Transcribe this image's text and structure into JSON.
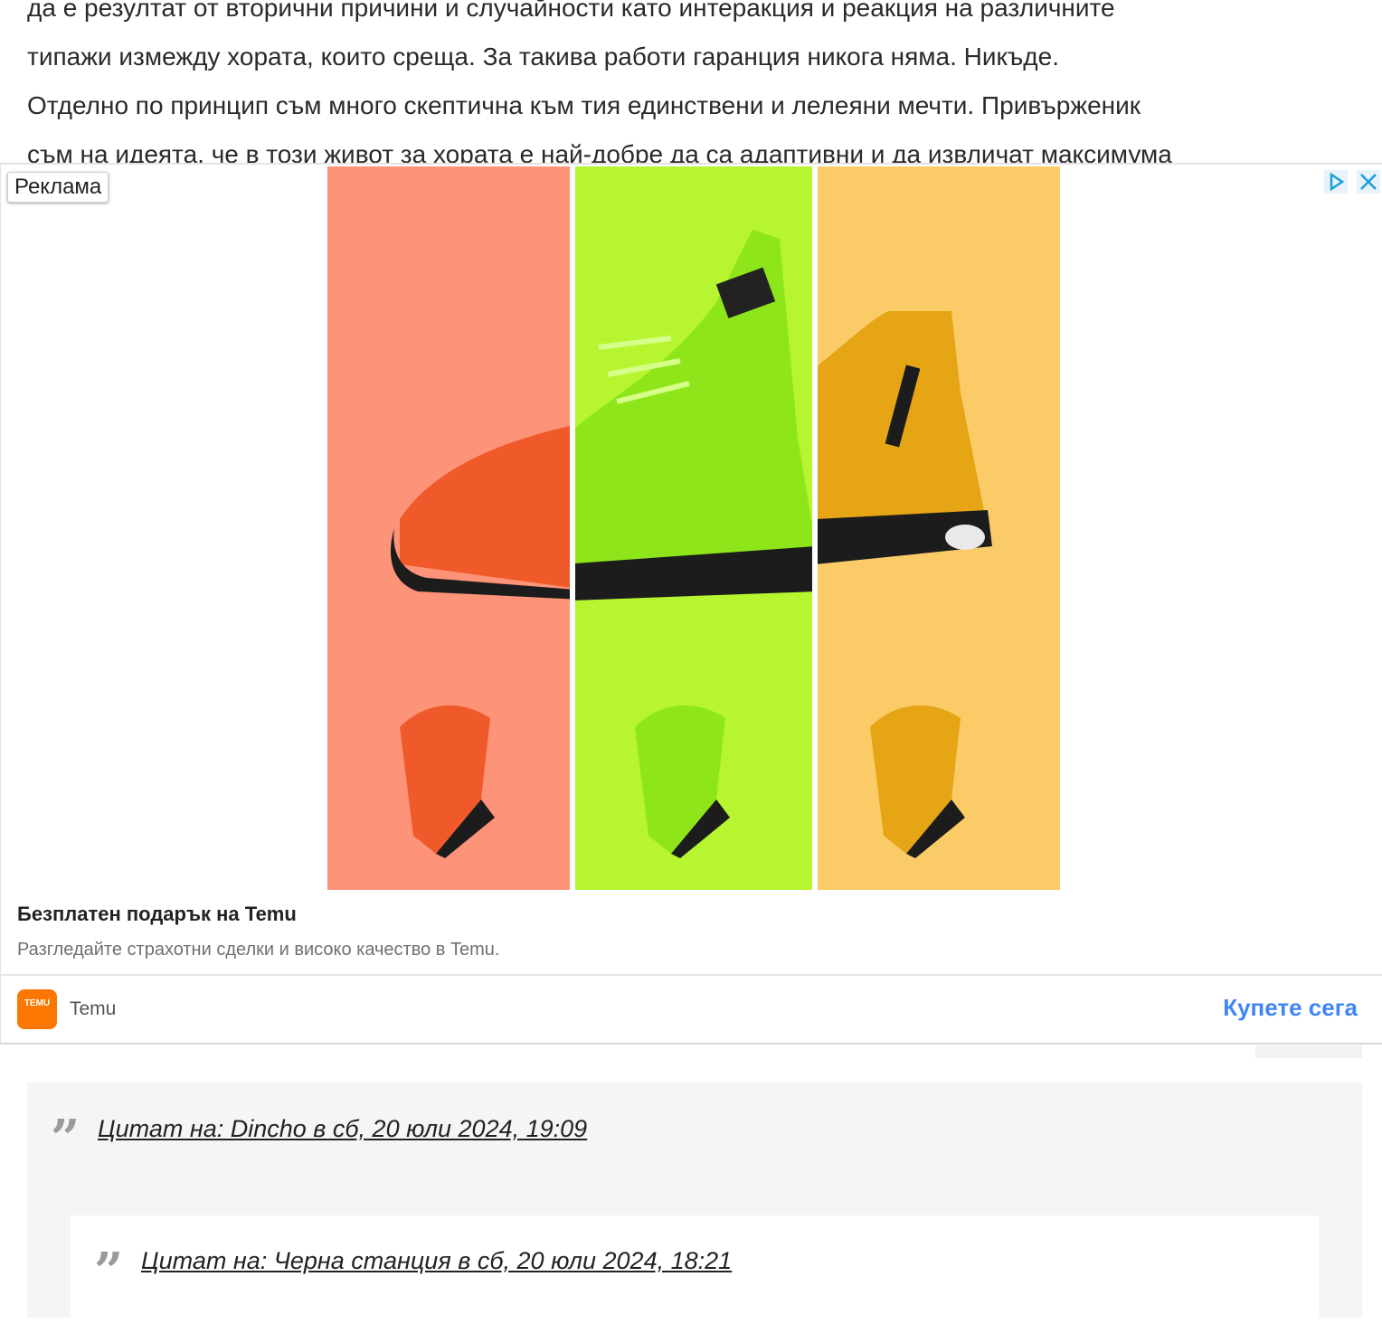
{
  "article": {
    "lines": [
      "да е резултат от вторични причини и случайности като интеракция и реакция на различните",
      "типажи измежду хората, които среща. За такива работи гаранция никога няма. Никъде.",
      "Отделно по принцип съм много скептична към тия единствени и лелеяни мечти. Привърженик",
      "съм на идеята, че в този живот за хората е най-добре да са адаптивни и да извличат максимума"
    ]
  },
  "ad": {
    "label": "Реклама",
    "title": "Безплатен подарък на Temu",
    "description": "Разгледайте страхотни сделки и високо качество в Temu.",
    "advertiser": "Temu",
    "logo_text": "TEMU",
    "cta": "Купете сега",
    "panel_colors": [
      "#fd9378",
      "#b6f52f",
      "#fbcb68"
    ],
    "shoe_colors": [
      "#f05a2b",
      "#8ee61a",
      "#e6a515"
    ],
    "icons": [
      "adchoices-icon",
      "close-icon"
    ]
  },
  "quotes": {
    "outer": "Цитат на: Dincho в сб, 20 юли 2024, 19:09",
    "inner": "Цитат на: Черна станция в сб, 20 юли 2024, 18:21"
  }
}
